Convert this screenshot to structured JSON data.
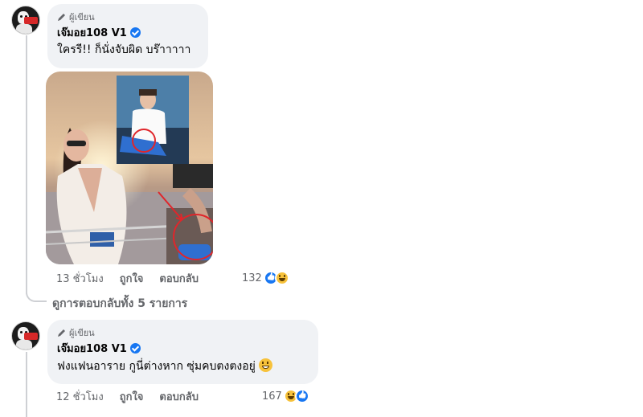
{
  "comments": [
    {
      "author_tag": "ผู้เขียน",
      "author_name": "เจ๊มอย108 V1",
      "text": "ใครรี!! ก็นั่งจับผิด บร๊าาาาา",
      "time": "13 ชั่วโมง",
      "like_label": "ถูกใจ",
      "reply_label": "ตอบกลับ",
      "reaction_count": "132",
      "reactions": [
        "like-icon",
        "haha-icon"
      ],
      "view_replies": "ดูการตอบกลับทั้ง 5 รายการ"
    },
    {
      "author_tag": "ผู้เขียน",
      "author_name": "เจ๊มอย108 V1",
      "text": "ฟงแฟนอาราย กูนี่ต่างหาก ซุ่มคบตงตงอยู่",
      "text_emoji": "grinning-face-icon",
      "time": "12 ชั่วโมง",
      "like_label": "ถูกใจ",
      "reply_label": "ตอบกลับ",
      "reaction_count": "167",
      "reactions": [
        "haha-icon",
        "like-icon"
      ]
    }
  ],
  "colors": {
    "bubble": "#f0f2f5",
    "meta_text": "#65676b",
    "verified": "#1877f2",
    "annotation_red": "#e0262b"
  }
}
